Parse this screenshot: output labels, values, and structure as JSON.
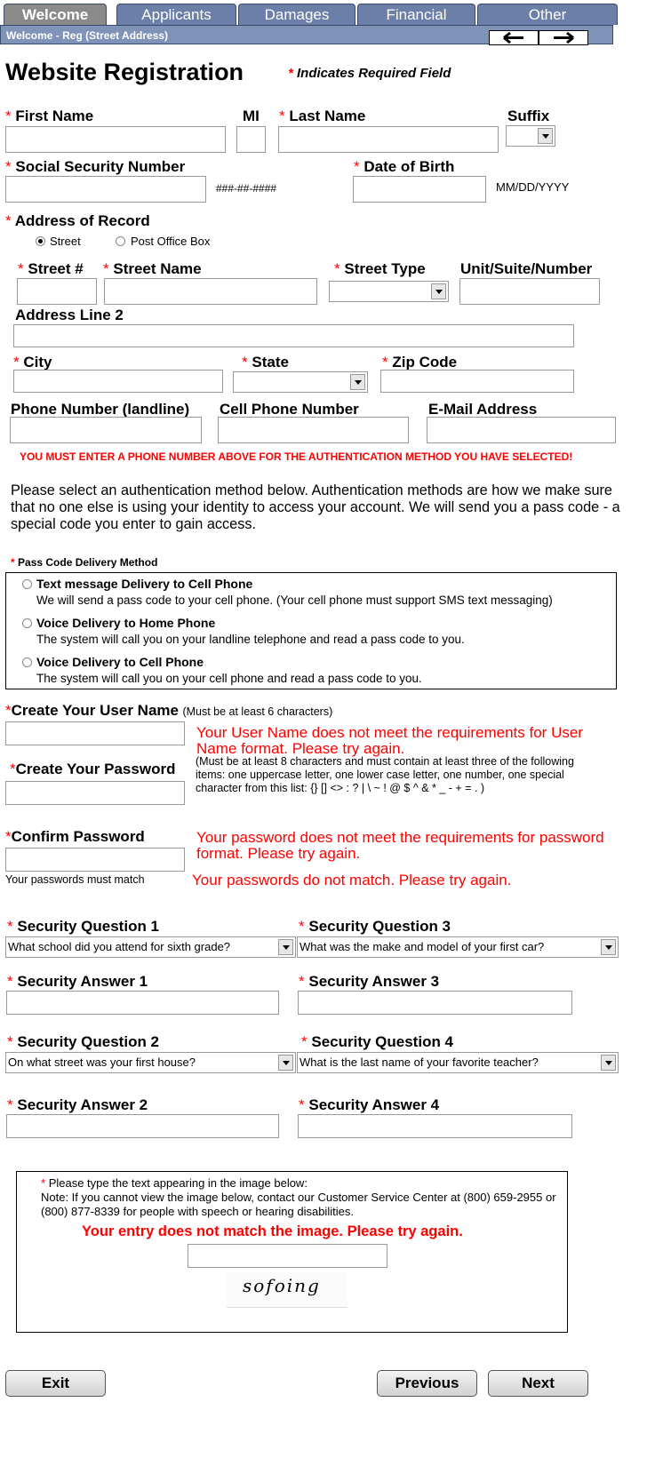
{
  "tabs": [
    "Welcome",
    "Applicants",
    "Damages",
    "Financial",
    "Other"
  ],
  "subbar": "Welcome - Reg (Street Address)",
  "title": "Website Registration",
  "required_note": "Indicates Required Field",
  "asterisk": "*",
  "fields": {
    "first_name": "First Name",
    "mi": "MI",
    "last_name": "Last Name",
    "suffix": "Suffix",
    "ssn": "Social Security Number",
    "ssn_hint": "###-##-####",
    "dob": "Date of Birth",
    "dob_hint": "MM/DD/YYYY",
    "address_of_record": "Address of Record",
    "radio_street": "Street",
    "radio_po": "Post Office Box",
    "street_num": "Street #",
    "street_name": "Street Name",
    "street_type": "Street Type",
    "unit": "Unit/Suite/Number",
    "address2": "Address Line 2",
    "city": "City",
    "state": "State",
    "zip": "Zip Code",
    "phone": "Phone Number (landline)",
    "cell": "Cell Phone Number",
    "email": "E-Mail Address"
  },
  "phone_error": "YOU MUST ENTER A PHONE NUMBER ABOVE FOR THE AUTHENTICATION METHOD YOU HAVE SELECTED!",
  "auth_intro": "Please select an authentication method below.  Authentication methods are how we make sure that no one else is using your identity to access your account.   We will send you a pass code - a special code you enter to gain access.",
  "passcode": {
    "label": "Pass Code Delivery Method",
    "options": [
      {
        "title": "Text message Delivery to Cell Phone",
        "desc": "We will send a pass code to your cell phone. (Your cell phone must support SMS text messaging)"
      },
      {
        "title": "Voice Delivery to Home Phone",
        "desc": "The system will call you on your landline telephone and read a pass code to you."
      },
      {
        "title": "Voice Delivery to Cell Phone",
        "desc": "The system will call you on your cell phone and read a pass code to you."
      }
    ]
  },
  "account": {
    "username_label": "Create Your User Name",
    "username_hint": "(Must be at least 6 characters)",
    "username_error": "Your User Name does not meet the requirements for User Name format.   Please try again.",
    "password_label": "Create Your Password",
    "password_hint": "(Must be at least 8 characters and must contain at least three of the following items: one uppercase letter, one lower case letter, one number, one special character from this list: {} [] <> : ? | \\ ~ ! @ $ ^ & * _ - + = . )",
    "confirm_label": "Confirm Password",
    "password_error": "Your password does not meet the requirements for password format.  Please try again.",
    "match_hint": "Your passwords must match",
    "match_error": "Your passwords do not match.  Please try again."
  },
  "security": {
    "q1_label": "Security Question 1",
    "q1_value": "What school did you attend for sixth grade?",
    "q3_label": "Security Question 3",
    "q3_value": "What was the make and model of your first car?",
    "a1_label": "Security Answer 1",
    "a3_label": "Security Answer 3",
    "q2_label": "Security Question 2",
    "q2_value": "On what street was your first house?",
    "q4_label": "Security Question 4",
    "q4_value": "What is the last name of your favorite teacher?",
    "a2_label": "Security Answer 2",
    "a4_label": "Security Answer 4"
  },
  "captcha": {
    "instruction": "Please type the text appearing in the image below:",
    "note": "Note: If you cannot view the image below, contact our Customer Service Center at (800) 659-2955 or (800) 877-8339 for people with speech or hearing disabilities.",
    "error": "Your entry does not match the image.  Please try again.",
    "image_text": "sofoing"
  },
  "buttons": {
    "exit": "Exit",
    "previous": "Previous",
    "next": "Next"
  }
}
